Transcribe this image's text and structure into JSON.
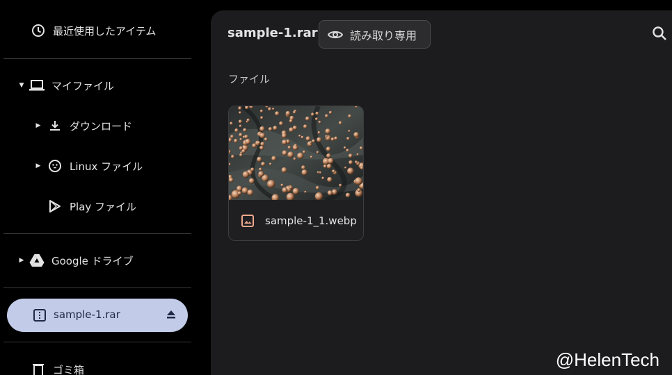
{
  "sidebar": {
    "recent": "最近使用したアイテム",
    "my_files": "マイファイル",
    "downloads": "ダウンロード",
    "linux": "Linux ファイル",
    "play": "Play ファイル",
    "google_drive": "Google ドライブ",
    "archive": "sample-1.rar",
    "trash": "ゴミ箱"
  },
  "header": {
    "title": "sample-1.rar",
    "readonly": "読み取り専用"
  },
  "section": "ファイル",
  "files": [
    {
      "name": "sample-1_1.webp"
    }
  ],
  "watermark": "@HelenTech",
  "colors": {
    "selected_bg": "#c2cce8",
    "main_bg": "#1c1c1e",
    "image_icon": "#f0a98e"
  }
}
